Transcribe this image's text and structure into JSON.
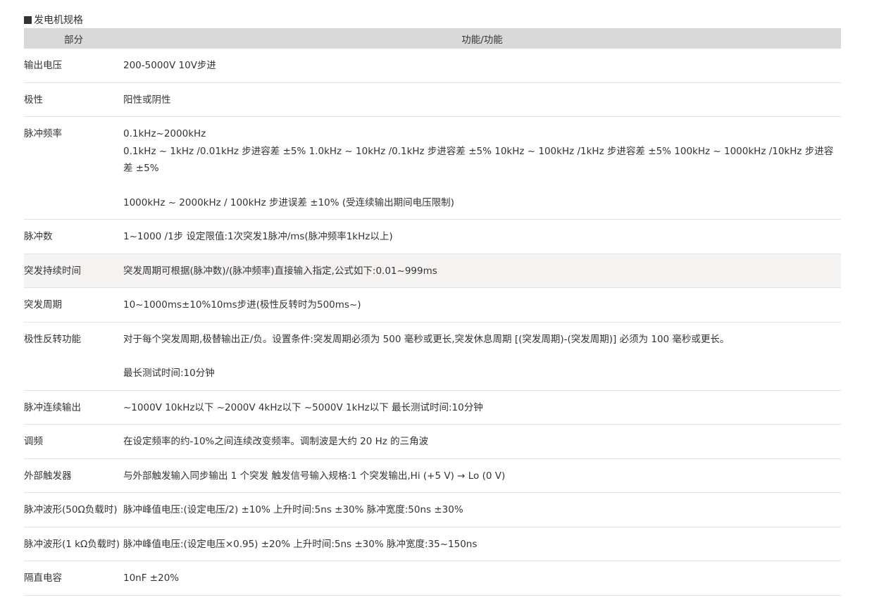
{
  "section_title": "发电机规格",
  "table": {
    "headers": [
      "部分",
      "功能/功能"
    ],
    "rows": [
      {
        "part": "输出电压",
        "func": [
          "200-5000V 10V步进"
        ],
        "shaded": false
      },
      {
        "part": "极性",
        "func": [
          "阳性或阴性"
        ],
        "shaded": false
      },
      {
        "part": "脉冲频率",
        "func": [
          "0.1kHz~2000kHz",
          "0.1kHz ~ 1kHz /0.01kHz 步进容差 ±5% 1.0kHz ~ 10kHz /0.1kHz 步进容差 ±5% 10kHz ~ 100kHz /1kHz 步进容差 ±5% 100kHz ~ 1000kHz /10kHz 步进容差 ±5%",
          "1000kHz ~ 2000kHz / 100kHz 步进误差 ±10% (受连续输出期间电压限制)"
        ],
        "gap_before": [
          false,
          false,
          true
        ],
        "shaded": false
      },
      {
        "part": "脉冲数",
        "func": [
          "1~1000 /1步 设定限值:1次突发1脉冲/ms(脉冲频率1kHz以上)"
        ],
        "shaded": false
      },
      {
        "part": "突发持续时间",
        "func": [
          "突发周期可根据(脉冲数)/(脉冲频率)直接输入指定,公式如下:0.01~999ms"
        ],
        "shaded": true
      },
      {
        "part": "突发周期",
        "func": [
          "10~1000ms±10%10ms步进(极性反转时为500ms~)"
        ],
        "shaded": false
      },
      {
        "part": "极性反转功能",
        "func": [
          "对于每个突发周期,极替输出正/负。设置条件:突发周期必须为 500 毫秒或更长,突发休息周期 [(突发周期)-(突发周期)] 必须为 100 毫秒或更长。",
          "最长测试时间:10分钟"
        ],
        "gap_before": [
          false,
          true
        ],
        "shaded": false
      },
      {
        "part": "脉冲连续输出",
        "func": [
          "~1000V 10kHz以下 ~2000V 4kHz以下 ~5000V 1kHz以下 最长测试时间:10分钟"
        ],
        "shaded": false
      },
      {
        "part": "调频",
        "func": [
          "在设定频率的约-10%之间连续改变频率。调制波是大约 20 Hz 的三角波"
        ],
        "shaded": false
      },
      {
        "part": "外部触发器",
        "func": [
          "与外部触发输入同步输出 1 个突发 触发信号输入规格:1 个突发输出,Hi (+5 V) → Lo (0 V)"
        ],
        "shaded": false
      },
      {
        "part": "脉冲波形(50Ω负载时)",
        "func": [
          "脉冲峰值电压:(设定电压/2) ±10% 上升时间:5ns ±30% 脉冲宽度:50ns ±30%"
        ],
        "shaded": false
      },
      {
        "part": "脉冲波形(1 kΩ负载时)",
        "func": [
          "脉冲峰值电压:(设定电压×0.95) ±20% 上升时间:5ns ±30% 脉冲宽度:35~150ns"
        ],
        "shaded": false
      },
      {
        "part": "隔直电容",
        "func": [
          "10nF ±20%"
        ],
        "shaded": false
      }
    ]
  }
}
